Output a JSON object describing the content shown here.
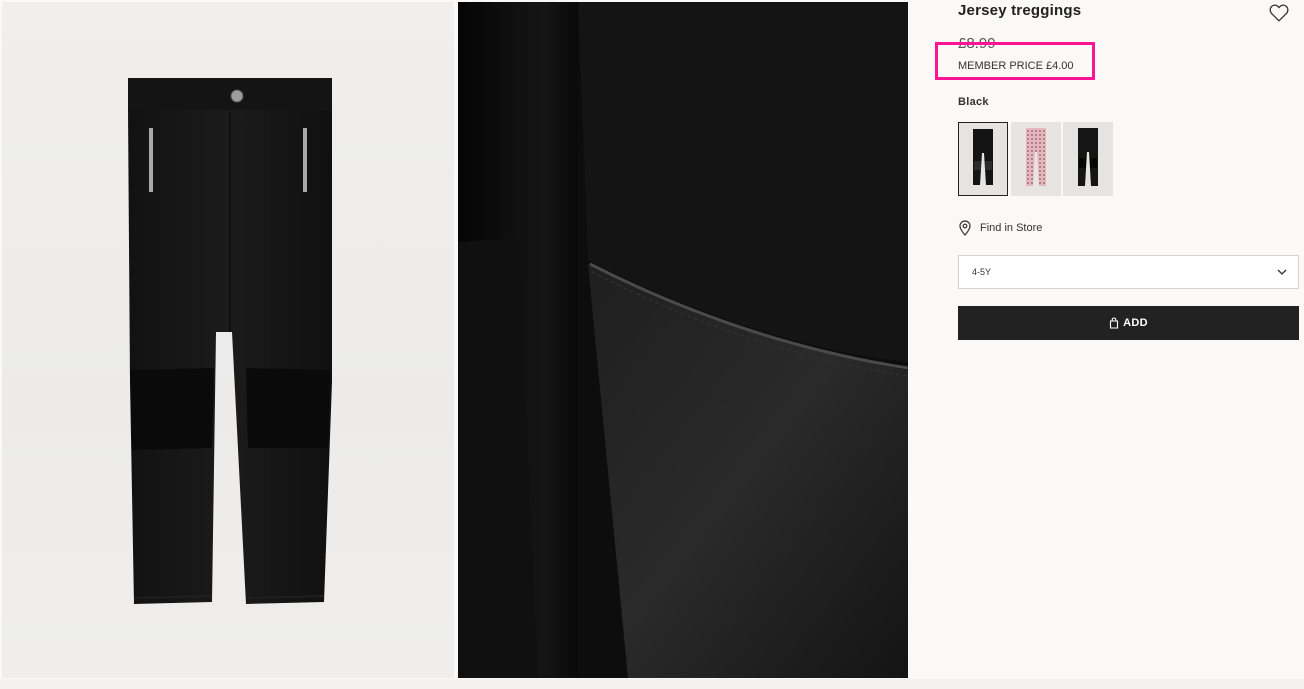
{
  "product": {
    "title": "Jersey treggings",
    "price_original": "£8.99",
    "member_price": "MEMBER PRICE £4.00",
    "color_name": "Black",
    "find_in_store": "Find in Store",
    "size_selected": "4-5Y",
    "add_label": "ADD",
    "swatches": [
      {
        "icon": "black-treggings-thumb",
        "selected": true
      },
      {
        "icon": "pink-check-treggings-thumb",
        "selected": false
      },
      {
        "icon": "black-knee-patch-treggings-thumb",
        "selected": false
      }
    ],
    "icons": {
      "favorite": "heart-icon",
      "store": "location-pin-icon",
      "dropdown": "chevron-down-icon",
      "add": "shopping-bag-icon"
    }
  },
  "colors": {
    "highlight": "#ff1493",
    "button": "#222222",
    "page_bg": "#faf9f8"
  }
}
